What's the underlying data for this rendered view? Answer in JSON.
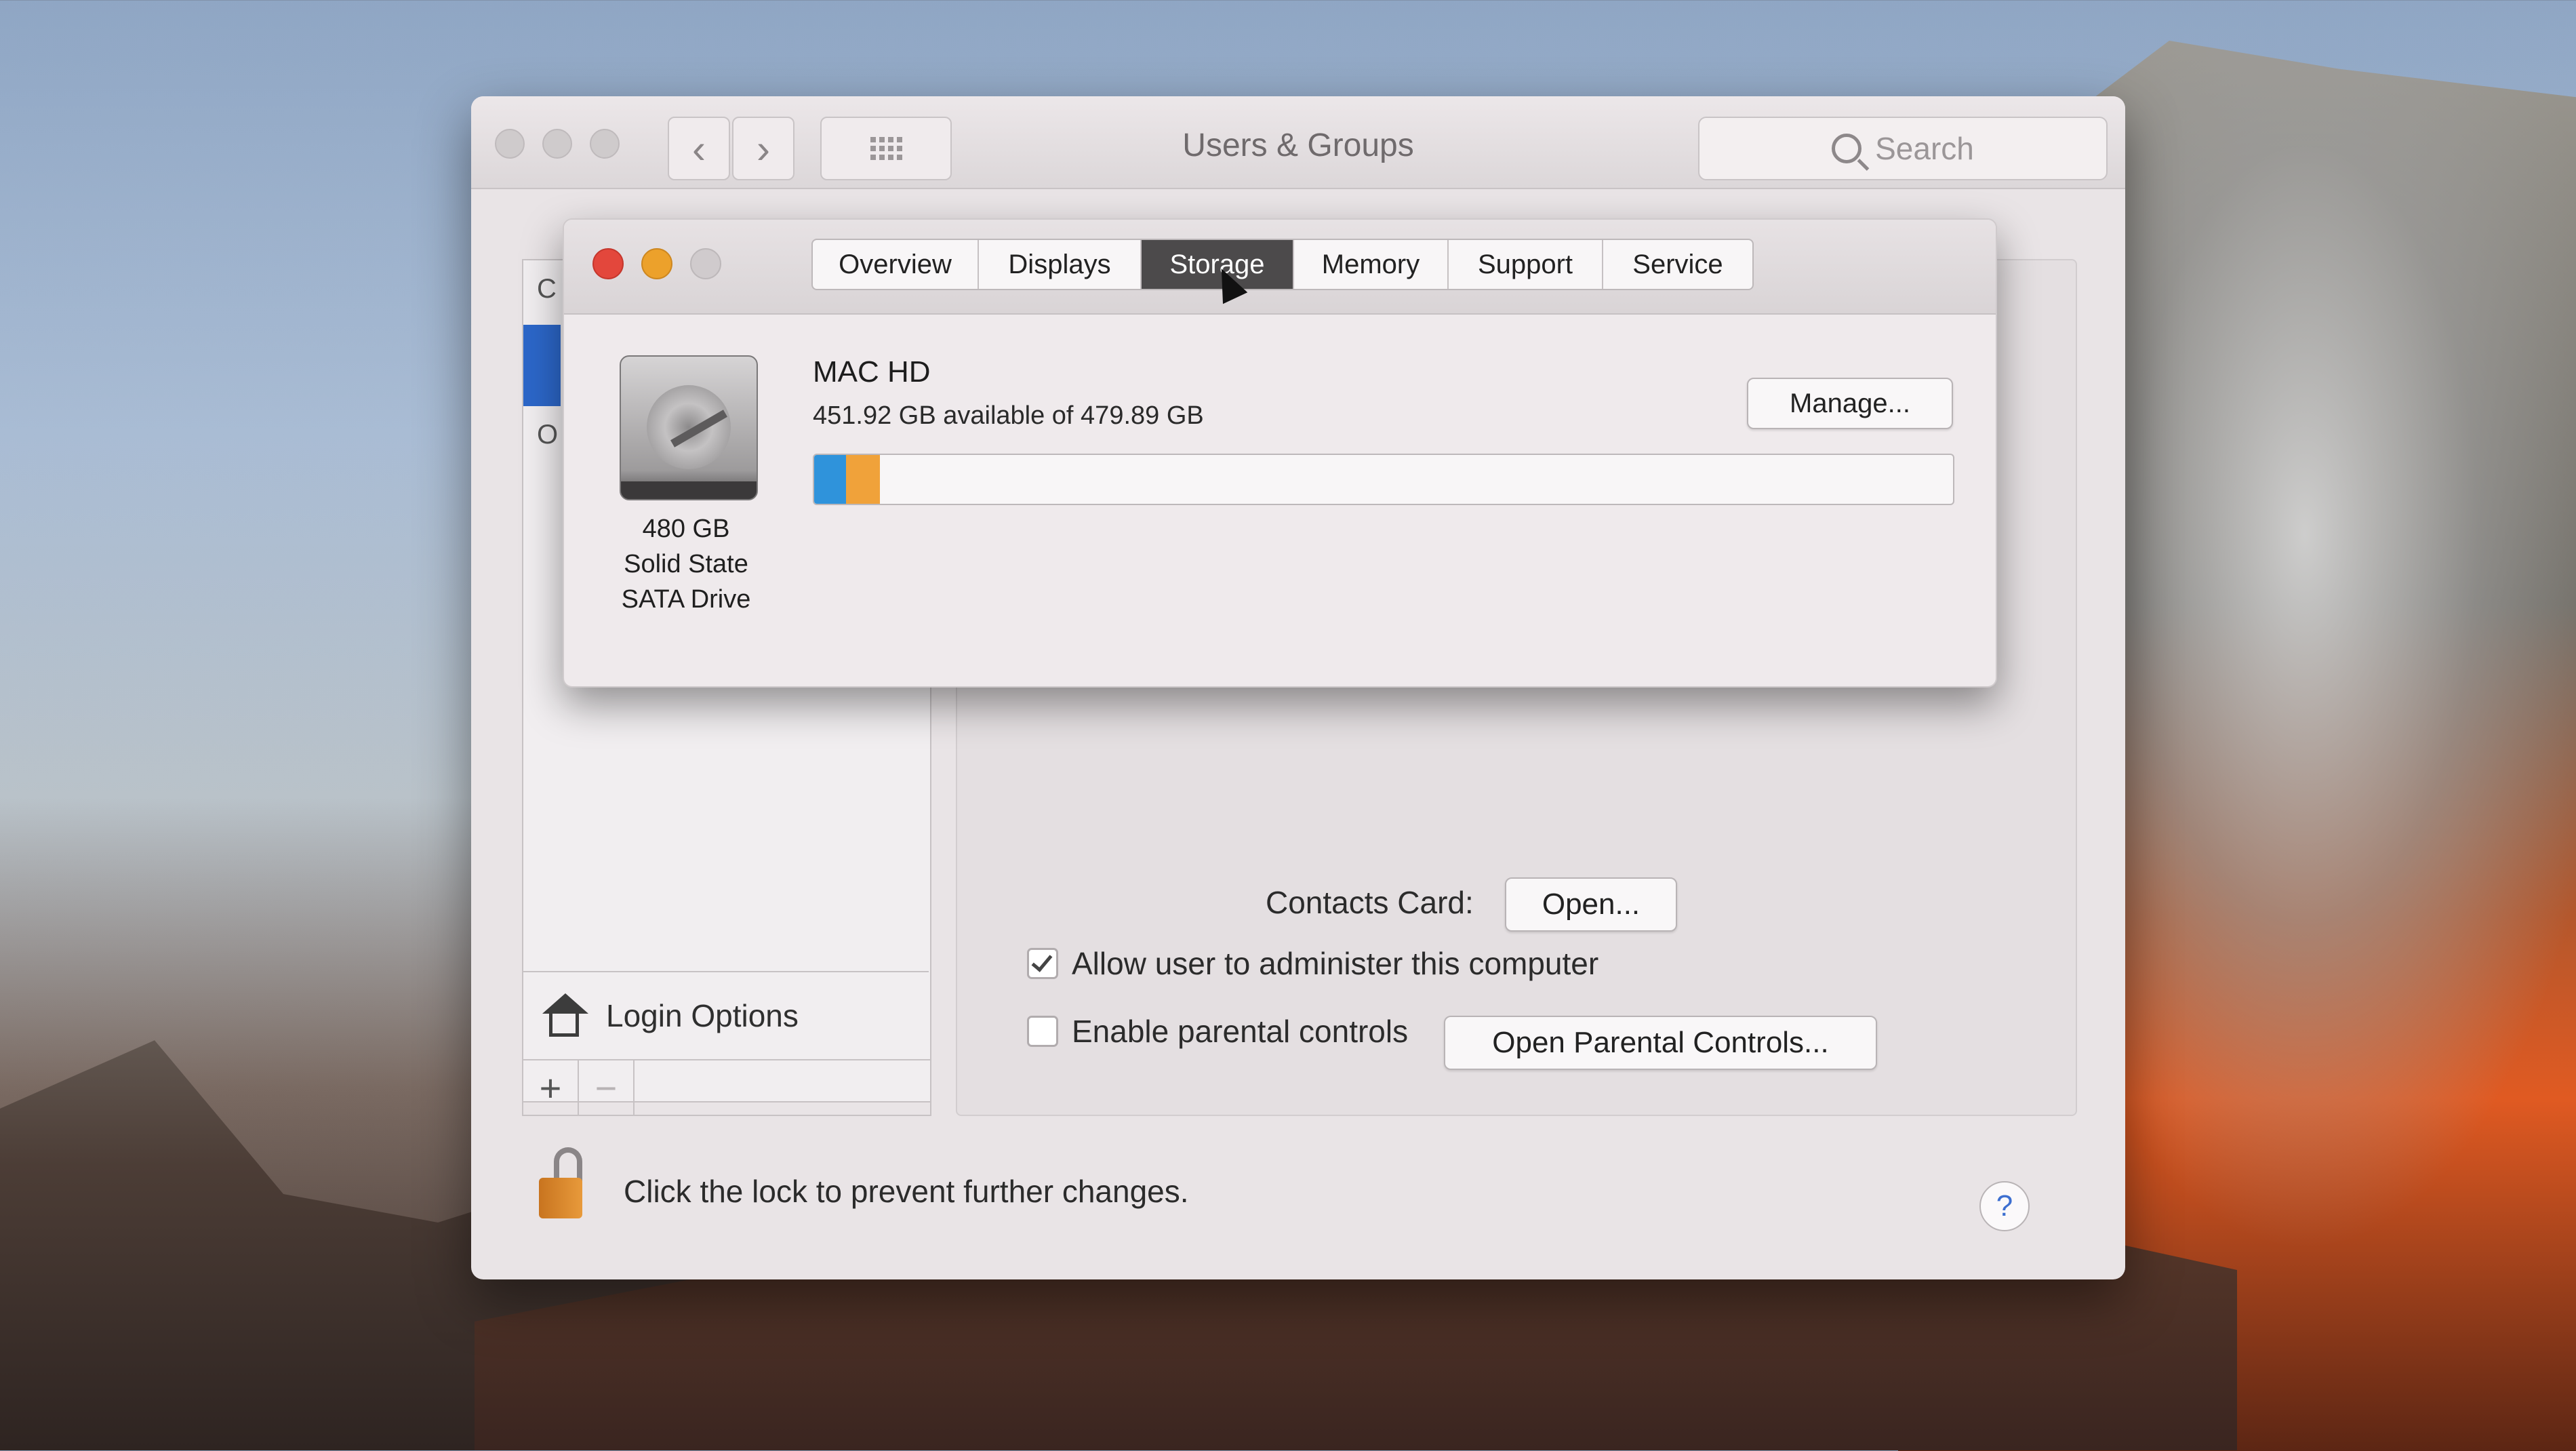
{
  "preferences": {
    "title": "Users & Groups",
    "search_placeholder": "Search",
    "nav_back": "‹",
    "nav_forward": "›",
    "users_list_fragments": [
      "C",
      "O"
    ],
    "login_options_label": "Login Options",
    "add_symbol": "+",
    "remove_symbol": "−",
    "contacts_card_label": "Contacts Card:",
    "open_button": "Open...",
    "admin_checkbox_label": "Allow user to administer this computer",
    "admin_checked": true,
    "parental_checkbox_label": "Enable parental controls",
    "parental_checked": false,
    "parental_button": "Open Parental Controls...",
    "lock_text": "Click the lock to prevent further changes.",
    "help_symbol": "?"
  },
  "about": {
    "tabs": [
      {
        "label": "Overview",
        "active": false
      },
      {
        "label": "Displays",
        "active": false
      },
      {
        "label": "Storage",
        "active": true
      },
      {
        "label": "Memory",
        "active": false
      },
      {
        "label": "Support",
        "active": false
      },
      {
        "label": "Service",
        "active": false
      }
    ],
    "drive_caption": [
      "480 GB",
      "Solid State",
      "SATA Drive"
    ],
    "disk_name": "MAC HD",
    "disk_availability": "451.92 GB available of 479.89 GB",
    "manage_button": "Manage...",
    "storage_segments": [
      {
        "kind": "blue",
        "fraction": 0.028,
        "color": "#2f93db"
      },
      {
        "kind": "orange",
        "fraction": 0.03,
        "color": "#f0a23a"
      }
    ]
  }
}
